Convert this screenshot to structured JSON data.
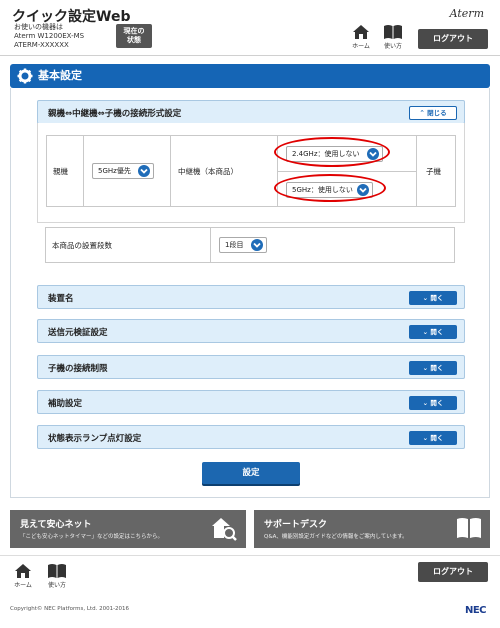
{
  "header": {
    "app_title": "クイック設定Web",
    "device_line1": "お使いの機器は",
    "device_line2": "Aterm W1200EX-MS",
    "device_line3": "ATERM-XXXXXX",
    "status_label_line1": "現在の",
    "status_label_line2": "状態",
    "brand": "Aterm",
    "home_label": "ホーム",
    "usage_label": "使い方",
    "logout_label": "ログアウト"
  },
  "section": {
    "title": "基本設定"
  },
  "connection": {
    "title": "親機⇔中継機⇔子機の接続形式設定",
    "toggle_label": "閉じる",
    "parent_label": "親機",
    "parent_value": "5GHz優先",
    "repeater_label": "中継機（本商品）",
    "repeater_24_value": "2.4GHz：使用しない",
    "repeater_5_value": "5GHz：使用しない",
    "child_label": "子機",
    "stage_label": "本商品の設置段数",
    "stage_value": "1段目"
  },
  "accordions": [
    {
      "title": "装置名",
      "toggle_label": "開く"
    },
    {
      "title": "送信元検証設定",
      "toggle_label": "開く"
    },
    {
      "title": "子機の接続制限",
      "toggle_label": "開く"
    },
    {
      "title": "補助設定",
      "toggle_label": "開く"
    },
    {
      "title": "状態表示ランプ点灯設定",
      "toggle_label": "開く"
    }
  ],
  "submit_label": "設定",
  "promos": {
    "safety_title": "見えて安心ネット",
    "safety_desc": "「こども安心ネットタイマー」などの設定はこちらから。",
    "support_title": "サポートデスク",
    "support_desc": "Q&A、機能別設定ガイドなどの情報をご案内しています。"
  },
  "footer": {
    "home_label": "ホーム",
    "usage_label": "使い方",
    "logout_label": "ログアウト",
    "copyright": "Copyright© NEC Platforms, Ltd. 2001-2016",
    "logo": "NEC"
  },
  "colors": {
    "primary_blue": "#1565b5",
    "accordion_bg": "#deeefa",
    "highlight_red": "#e00000",
    "dark_button": "#4a4a4a"
  }
}
